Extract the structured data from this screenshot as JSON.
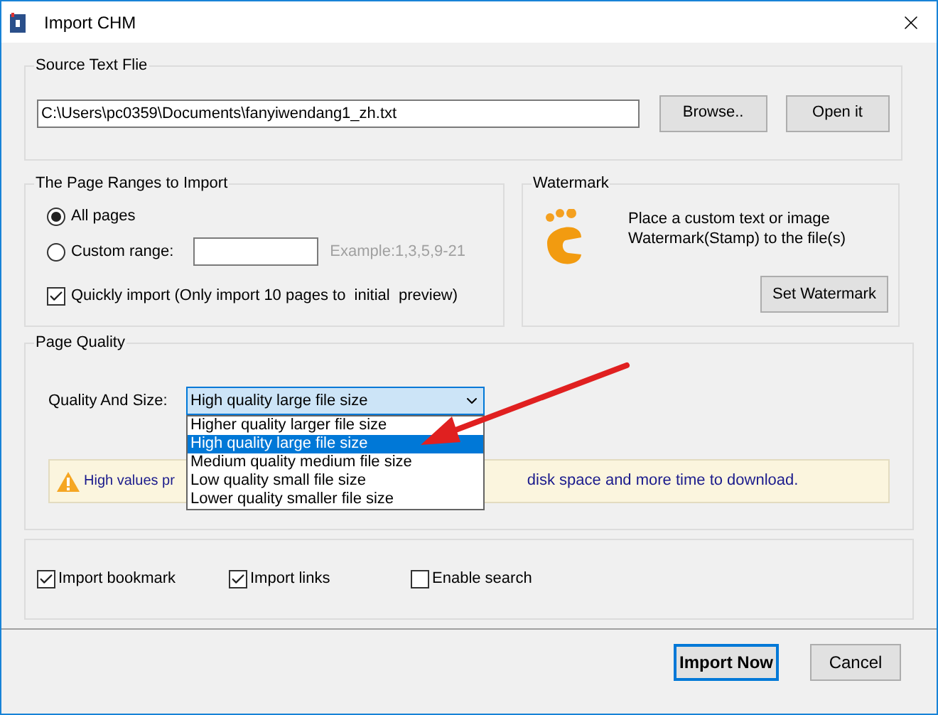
{
  "window": {
    "title": "Import CHM"
  },
  "source": {
    "legend": "Source Text Flie",
    "path": "C:\\Users\\pc0359\\Documents\\fanyiwendang1_zh.txt",
    "buttons": [
      "Browse..",
      "Open it"
    ]
  },
  "page_ranges": {
    "legend": "The Page Ranges to Import",
    "options": [
      {
        "label": "All pages",
        "selected": true
      },
      {
        "label": "Custom range:",
        "selected": false
      }
    ],
    "range_hint": "Example:1,3,5,9-21",
    "quick_import": {
      "label": "Quickly import (Only import 10 pages to  initial  preview)",
      "checked": true
    }
  },
  "watermark": {
    "legend": "Watermark",
    "description": "Place a custom text or image Watermark(Stamp) to the file(s)",
    "button": "Set Watermark"
  },
  "page_quality": {
    "legend": "Page Quality",
    "label": "Quality And Size:",
    "value": "High quality large file size",
    "expanded": true,
    "options": [
      {
        "label": "Higher quality larger file size",
        "selected": false
      },
      {
        "label": "High quality large file size",
        "selected": true
      },
      {
        "label": "Medium quality medium file size",
        "selected": false
      },
      {
        "label": "Low quality small file size",
        "selected": false
      },
      {
        "label": "Lower quality smaller file size",
        "selected": false
      }
    ],
    "warning": [
      "High values pr",
      "disk space and more time to download."
    ]
  },
  "options": [
    {
      "label": "Import bookmark",
      "checked": true
    },
    {
      "label": "Import links",
      "checked": true
    },
    {
      "label": "Enable search",
      "checked": false
    }
  ],
  "buttons": [
    {
      "label": "Import Now",
      "default": true
    },
    {
      "label": "Cancel",
      "default": false
    }
  ]
}
